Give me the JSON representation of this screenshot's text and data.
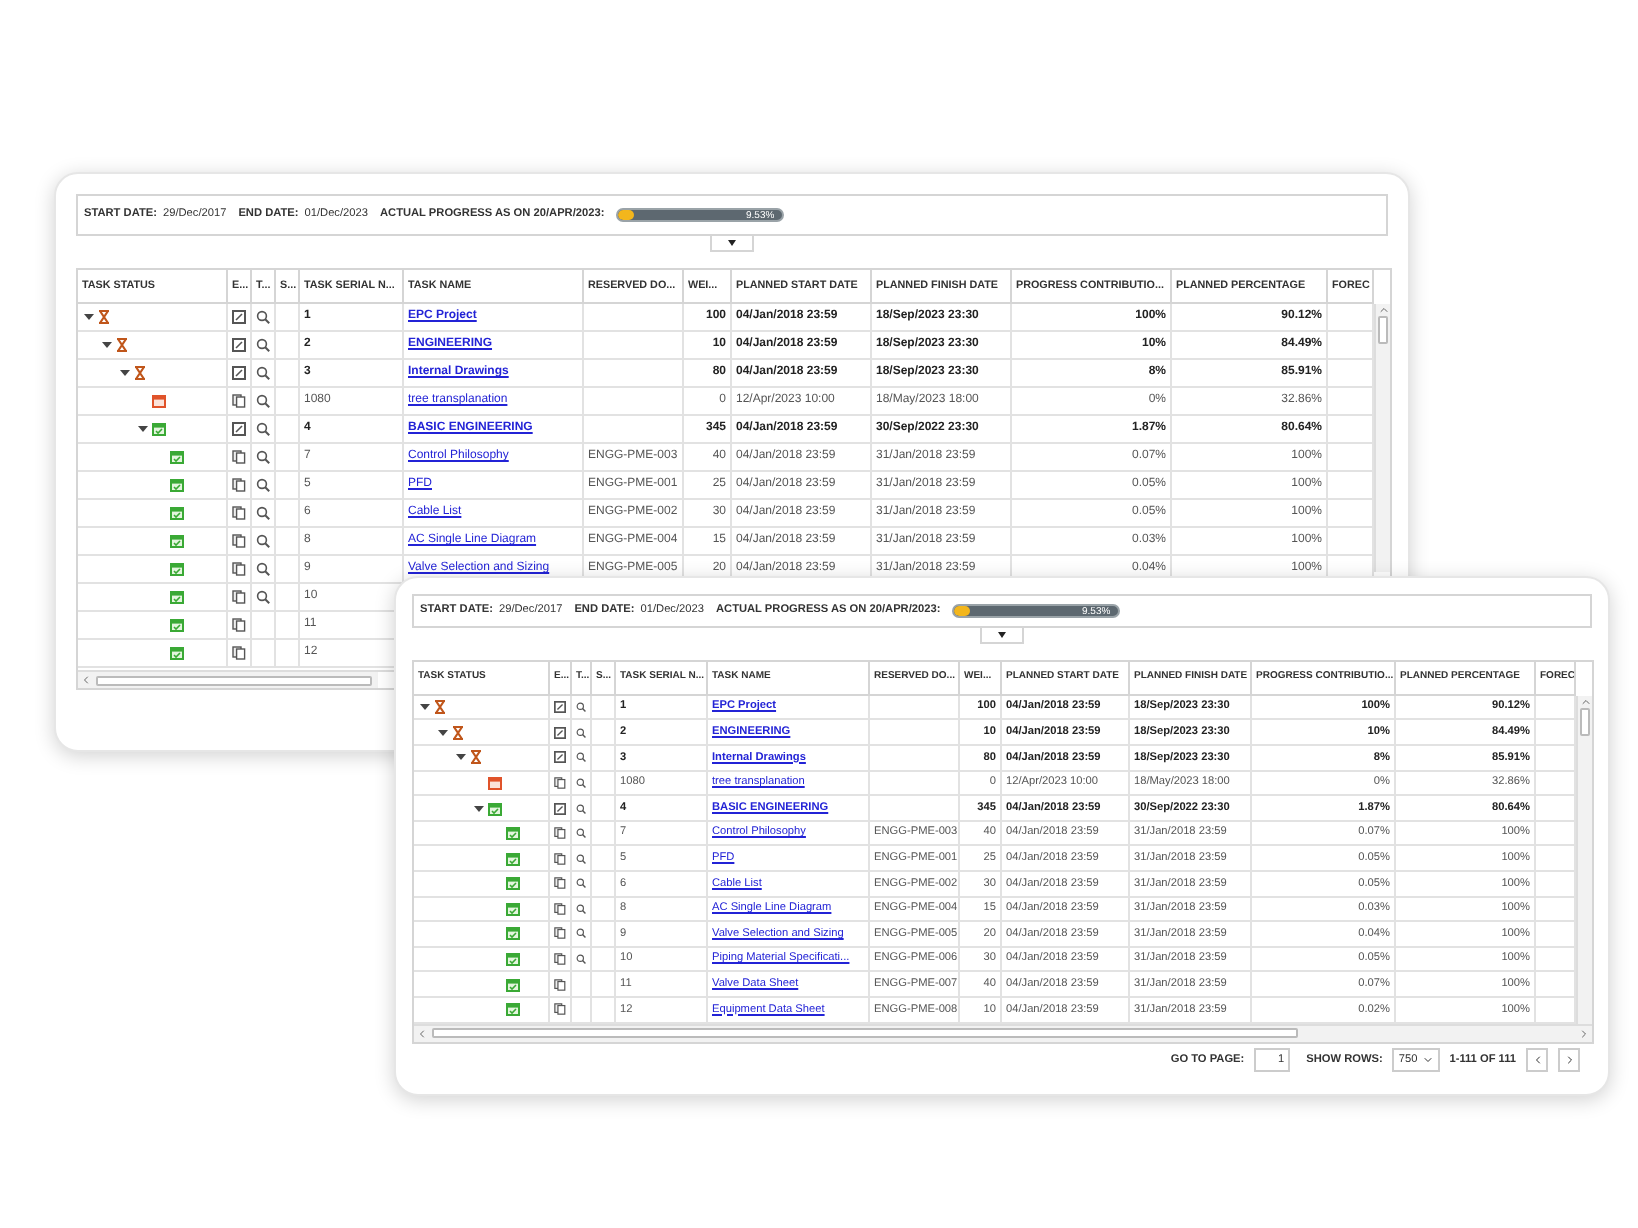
{
  "windows": [
    {
      "header": {
        "start_label": "START DATE:",
        "start": "29/Dec/2017",
        "end_label": "END DATE:",
        "end": "01/Dec/2023",
        "progress_label": "ACTUAL PROGRESS AS ON 20/APR/2023:",
        "progress": {
          "level": 0.0953,
          "reading": "9.53%"
        },
        "toggle_expanded": true
      },
      "columns": [
        "TASK STATUS",
        "E...",
        "T...",
        "S...",
        "TASK SERIAL N...",
        "TASK NAME",
        "RESERVED DO...",
        "WEI...",
        "PLANNED START DATE",
        "PLANNED FINISH DATE",
        "PROGRESS CONTRIBUTIO...",
        "PLANNED PERCENTAGE",
        "FOREC"
      ],
      "rows": [
        {
          "complete": false,
          "overdue": false,
          "expanded": true,
          "kind": "summary",
          "lookup": true,
          "serial": "1",
          "name": "EPC Project",
          "weight": "100",
          "start": "04/Jan/2018 23:59",
          "finish": "18/Sep/2023 23:30",
          "contribution": "100%",
          "planned": "90.12%",
          "children": [
            {
              "complete": false,
              "overdue": false,
              "expanded": true,
              "kind": "summary",
              "lookup": true,
              "serial": "2",
              "name": "ENGINEERING",
              "weight": "10",
              "start": "04/Jan/2018 23:59",
              "finish": "18/Sep/2023 23:30",
              "contribution": "10%",
              "planned": "84.49%",
              "children": [
                {
                  "complete": false,
                  "overdue": false,
                  "expanded": true,
                  "kind": "summary",
                  "lookup": true,
                  "serial": "3",
                  "name": "Internal Drawings",
                  "weight": "80",
                  "start": "04/Jan/2018 23:59",
                  "finish": "18/Sep/2023 23:30",
                  "contribution": "8%",
                  "planned": "85.91%",
                  "children": [
                    {
                      "complete": false,
                      "overdue": true,
                      "kind": "task",
                      "lookup": true,
                      "serial": "1080",
                      "name": "tree transplanation",
                      "weight": "0",
                      "start": "12/Apr/2023 10:00",
                      "finish": "18/May/2023 18:00",
                      "contribution": "0%",
                      "planned": "32.86%"
                    },
                    {
                      "complete": true,
                      "overdue": false,
                      "expanded": true,
                      "kind": "summary",
                      "lookup": true,
                      "serial": "4",
                      "name": "BASIC ENGINEERING",
                      "weight": "345",
                      "start": "04/Jan/2018 23:59",
                      "finish": "30/Sep/2022 23:30",
                      "contribution": "1.87%",
                      "planned": "80.64%",
                      "children": [
                        {
                          "complete": true,
                          "overdue": false,
                          "kind": "task",
                          "lookup": true,
                          "serial": "7",
                          "name": "Control Philosophy",
                          "reserved": "ENGG-PME-003",
                          "weight": "40",
                          "start": "04/Jan/2018 23:59",
                          "finish": "31/Jan/2018 23:59",
                          "contribution": "0.07%",
                          "planned": "100%"
                        },
                        {
                          "complete": true,
                          "overdue": false,
                          "kind": "task",
                          "lookup": true,
                          "serial": "5",
                          "name": "PFD",
                          "reserved": "ENGG-PME-001",
                          "weight": "25",
                          "start": "04/Jan/2018 23:59",
                          "finish": "31/Jan/2018 23:59",
                          "contribution": "0.05%",
                          "planned": "100%"
                        },
                        {
                          "complete": true,
                          "overdue": false,
                          "kind": "task",
                          "lookup": true,
                          "serial": "6",
                          "name": "Cable List",
                          "reserved": "ENGG-PME-002",
                          "weight": "30",
                          "start": "04/Jan/2018 23:59",
                          "finish": "31/Jan/2018 23:59",
                          "contribution": "0.05%",
                          "planned": "100%"
                        },
                        {
                          "complete": true,
                          "overdue": false,
                          "kind": "task",
                          "lookup": true,
                          "serial": "8",
                          "name": "AC Single Line Diagram",
                          "reserved": "ENGG-PME-004",
                          "weight": "15",
                          "start": "04/Jan/2018 23:59",
                          "finish": "31/Jan/2018 23:59",
                          "contribution": "0.03%",
                          "planned": "100%"
                        },
                        {
                          "complete": true,
                          "overdue": false,
                          "kind": "task",
                          "lookup": true,
                          "serial": "9",
                          "name": "Valve Selection and Sizing",
                          "reserved": "ENGG-PME-005",
                          "weight": "20",
                          "start": "04/Jan/2018 23:59",
                          "finish": "31/Jan/2018 23:59",
                          "contribution": "0.04%",
                          "planned": "100%"
                        },
                        {
                          "complete": true,
                          "overdue": false,
                          "kind": "task",
                          "lookup": true,
                          "serial": "10"
                        },
                        {
                          "complete": true,
                          "overdue": false,
                          "kind": "task",
                          "lookup": false,
                          "serial": "11"
                        },
                        {
                          "complete": true,
                          "overdue": false,
                          "kind": "task",
                          "lookup": false,
                          "serial": "12"
                        }
                      ]
                    }
                  ]
                }
              ]
            }
          ]
        }
      ]
    },
    {
      "header": {
        "start_label": "START DATE:",
        "start": "29/Dec/2017",
        "end_label": "END DATE:",
        "end": "01/Dec/2023",
        "progress_label": "ACTUAL PROGRESS AS ON 20/APR/2023:",
        "progress": {
          "level": 0.0953,
          "reading": "9.53%"
        },
        "toggle_expanded": true
      },
      "columns": [
        "TASK STATUS",
        "E...",
        "T...",
        "S...",
        "TASK SERIAL N...",
        "TASK NAME",
        "RESERVED DO...",
        "WEI...",
        "PLANNED START DATE",
        "PLANNED FINISH DATE",
        "PROGRESS CONTRIBUTIO...",
        "PLANNED PERCENTAGE",
        "FOREC"
      ],
      "rows": [
        {
          "complete": false,
          "overdue": false,
          "expanded": true,
          "kind": "summary",
          "lookup": true,
          "serial": "1",
          "name": "EPC Project",
          "weight": "100",
          "start": "04/Jan/2018 23:59",
          "finish": "18/Sep/2023 23:30",
          "contribution": "100%",
          "planned": "90.12%",
          "children": [
            {
              "complete": false,
              "overdue": false,
              "expanded": true,
              "kind": "summary",
              "lookup": true,
              "serial": "2",
              "name": "ENGINEERING",
              "weight": "10",
              "start": "04/Jan/2018 23:59",
              "finish": "18/Sep/2023 23:30",
              "contribution": "10%",
              "planned": "84.49%",
              "children": [
                {
                  "complete": false,
                  "overdue": false,
                  "expanded": true,
                  "kind": "summary",
                  "lookup": true,
                  "serial": "3",
                  "name": "Internal Drawings",
                  "weight": "80",
                  "start": "04/Jan/2018 23:59",
                  "finish": "18/Sep/2023 23:30",
                  "contribution": "8%",
                  "planned": "85.91%",
                  "children": [
                    {
                      "complete": false,
                      "overdue": true,
                      "kind": "task",
                      "lookup": true,
                      "serial": "1080",
                      "name": "tree transplanation",
                      "weight": "0",
                      "start": "12/Apr/2023 10:00",
                      "finish": "18/May/2023 18:00",
                      "contribution": "0%",
                      "planned": "32.86%"
                    },
                    {
                      "complete": true,
                      "overdue": false,
                      "expanded": true,
                      "kind": "summary",
                      "lookup": true,
                      "serial": "4",
                      "name": "BASIC ENGINEERING",
                      "weight": "345",
                      "start": "04/Jan/2018 23:59",
                      "finish": "30/Sep/2022 23:30",
                      "contribution": "1.87%",
                      "planned": "80.64%",
                      "children": [
                        {
                          "complete": true,
                          "overdue": false,
                          "kind": "task",
                          "lookup": true,
                          "serial": "7",
                          "name": "Control Philosophy",
                          "reserved": "ENGG-PME-003",
                          "weight": "40",
                          "start": "04/Jan/2018 23:59",
                          "finish": "31/Jan/2018 23:59",
                          "contribution": "0.07%",
                          "planned": "100%"
                        },
                        {
                          "complete": true,
                          "overdue": false,
                          "kind": "task",
                          "lookup": true,
                          "serial": "5",
                          "name": "PFD",
                          "reserved": "ENGG-PME-001",
                          "weight": "25",
                          "start": "04/Jan/2018 23:59",
                          "finish": "31/Jan/2018 23:59",
                          "contribution": "0.05%",
                          "planned": "100%"
                        },
                        {
                          "complete": true,
                          "overdue": false,
                          "kind": "task",
                          "lookup": true,
                          "serial": "6",
                          "name": "Cable List",
                          "reserved": "ENGG-PME-002",
                          "weight": "30",
                          "start": "04/Jan/2018 23:59",
                          "finish": "31/Jan/2018 23:59",
                          "contribution": "0.05%",
                          "planned": "100%"
                        },
                        {
                          "complete": true,
                          "overdue": false,
                          "kind": "task",
                          "lookup": true,
                          "serial": "8",
                          "name": "AC Single Line Diagram",
                          "reserved": "ENGG-PME-004",
                          "weight": "15",
                          "start": "04/Jan/2018 23:59",
                          "finish": "31/Jan/2018 23:59",
                          "contribution": "0.03%",
                          "planned": "100%"
                        },
                        {
                          "complete": true,
                          "overdue": false,
                          "kind": "task",
                          "lookup": true,
                          "serial": "9",
                          "name": "Valve Selection and Sizing",
                          "reserved": "ENGG-PME-005",
                          "weight": "20",
                          "start": "04/Jan/2018 23:59",
                          "finish": "31/Jan/2018 23:59",
                          "contribution": "0.04%",
                          "planned": "100%"
                        },
                        {
                          "complete": true,
                          "overdue": false,
                          "kind": "task",
                          "lookup": true,
                          "serial": "10",
                          "name": "Piping Material Specificati...",
                          "reserved": "ENGG-PME-006",
                          "weight": "30",
                          "start": "04/Jan/2018 23:59",
                          "finish": "31/Jan/2018 23:59",
                          "contribution": "0.05%",
                          "planned": "100%"
                        },
                        {
                          "complete": true,
                          "overdue": false,
                          "kind": "task",
                          "lookup": false,
                          "serial": "11",
                          "name": "Valve Data Sheet",
                          "reserved": "ENGG-PME-007",
                          "weight": "40",
                          "start": "04/Jan/2018 23:59",
                          "finish": "31/Jan/2018 23:59",
                          "contribution": "0.07%",
                          "planned": "100%"
                        },
                        {
                          "complete": true,
                          "overdue": false,
                          "kind": "task",
                          "lookup": false,
                          "serial": "12",
                          "name": "Equipment Data Sheet",
                          "reserved": "ENGG-PME-008",
                          "weight": "10",
                          "start": "04/Jan/2018 23:59",
                          "finish": "31/Jan/2018 23:59",
                          "contribution": "0.02%",
                          "planned": "100%"
                        }
                      ]
                    }
                  ]
                }
              ]
            }
          ]
        }
      ],
      "pagination": {
        "goto_label": "GO TO PAGE:",
        "page": "1",
        "rows_label": "SHOW ROWS:",
        "rows": "750",
        "range": "1-111 OF 111"
      }
    }
  ]
}
